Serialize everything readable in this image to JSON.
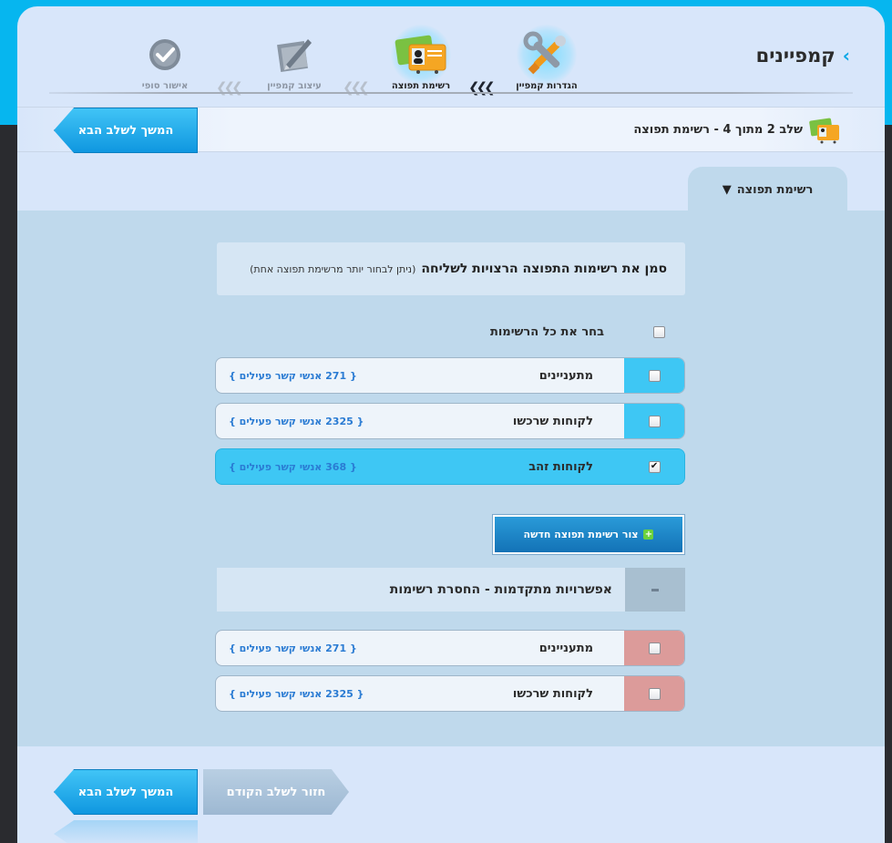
{
  "header": {
    "title": "קמפיינים",
    "steps": [
      {
        "label": "הגדרות קמפיין",
        "icon": "tools-icon",
        "state": "completed"
      },
      {
        "label": "רשימת תפוצה",
        "icon": "contact-cards-icon",
        "state": "current"
      },
      {
        "label": "עיצוב קמפיין",
        "icon": "design-pencil-icon",
        "state": "upcoming"
      },
      {
        "label": "אישור סופי",
        "icon": "checkmark-icon",
        "state": "upcoming"
      }
    ]
  },
  "step_bar": {
    "text": "שלב 2 מתוך 4 - רשימת תפוצה",
    "next_label": "המשך לשלב הבא"
  },
  "tab": {
    "label": "רשימת תפוצה"
  },
  "instructions": {
    "main": "סמן את רשימות התפוצה הרצויות לשליחה",
    "sub": "(ניתן לבחור יותר מרשימת תפוצה אחת)"
  },
  "select_all": {
    "label": "בחר את כל הרשימות",
    "checked": false
  },
  "lists": [
    {
      "name": "מתעניינים",
      "count": "{ 271 אנשי קשר פעילים }",
      "checked": false
    },
    {
      "name": "לקוחות שרכשו",
      "count": "{ 2325 אנשי קשר פעילים }",
      "checked": false
    },
    {
      "name": "לקוחות זהב",
      "count": "{ 368 אנשי קשר פעילים }",
      "checked": true
    }
  ],
  "create_list_label": "צור רשימת תפוצה חדשה",
  "advanced": {
    "title": "אפשרויות מתקדמות - החסרת רשימות",
    "exclude_lists": [
      {
        "name": "מתעניינים",
        "count": "{ 271 אנשי קשר פעילים }",
        "checked": false
      },
      {
        "name": "לקוחות שרכשו",
        "count": "{ 2325 אנשי קשר פעילים }",
        "checked": false
      }
    ]
  },
  "footer": {
    "prev_label": "חזור לשלב הקודם",
    "next_label": "המשך לשלב הבא"
  },
  "colors": {
    "accent": "#3ec7f4",
    "exclude": "#dc9b9a",
    "link_blue": "#2a7bd3"
  }
}
